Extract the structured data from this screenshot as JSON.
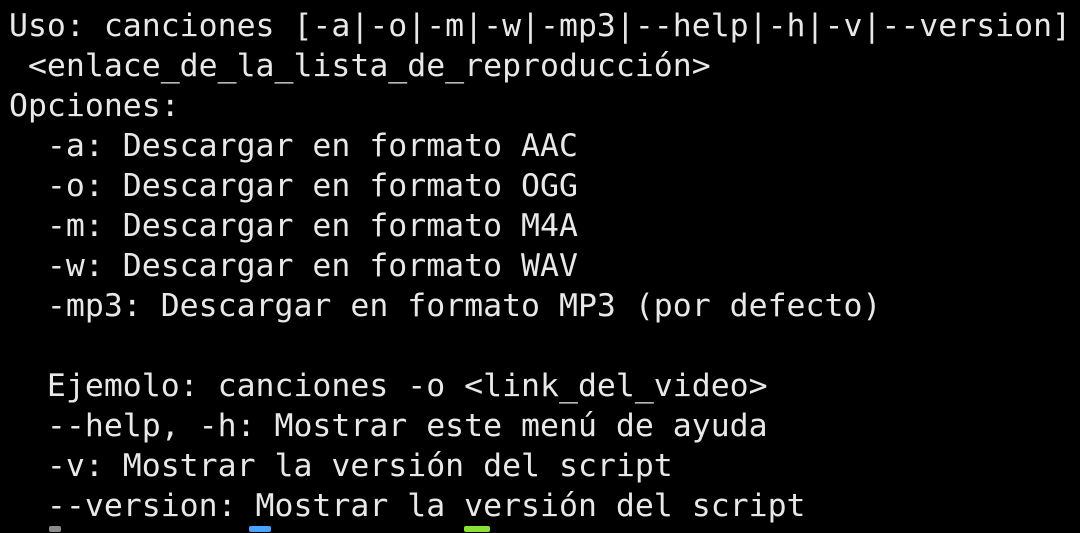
{
  "terminal": {
    "background": "#000000",
    "foreground": "#e8e8e8",
    "lines": [
      "Uso: canciones [-a|-o|-m|-w|-mp3|--help|-h|-v|--version]",
      " <enlace_de_la_lista_de_reproducción>",
      "Opciones:",
      "  -a: Descargar en formato AAC",
      "  -o: Descargar en formato OGG",
      "  -m: Descargar en formato M4A",
      "  -w: Descargar en formato WAV",
      "  -mp3: Descargar en formato MP3 (por defecto)",
      "",
      "  Ejemolo: canciones -o <link_del_video>",
      "  --help, -h: Mostrar este menú de ayuda",
      "  -v: Mostrar la versión del script",
      "  --version: Mostrar la versión del script"
    ],
    "prompt_colors": {
      "user": "#4aa3ff",
      "path": "#8ae234"
    }
  }
}
